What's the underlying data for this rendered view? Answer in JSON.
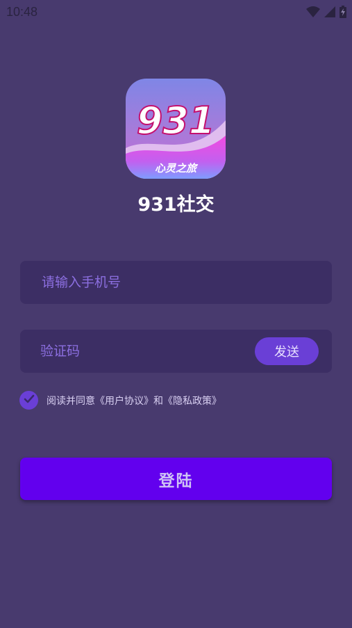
{
  "status_bar": {
    "time": "10:48",
    "icons": [
      "wifi-icon",
      "cell-signal-icon",
      "battery-charging-icon"
    ]
  },
  "app": {
    "logo_number": "931",
    "logo_tagline": "心灵之旅",
    "name": "931社交"
  },
  "form": {
    "phone_placeholder": "请输入手机号",
    "code_placeholder": "验证码",
    "send_label": "发送",
    "agreement_text": "阅读并同意《用户协议》和《隐私政策》",
    "agreement_checked": true,
    "login_label": "登陆"
  },
  "colors": {
    "background": "#483a6e",
    "field": "#3c2e64",
    "accent": "#6a3fd6",
    "primary": "#6200ee"
  }
}
